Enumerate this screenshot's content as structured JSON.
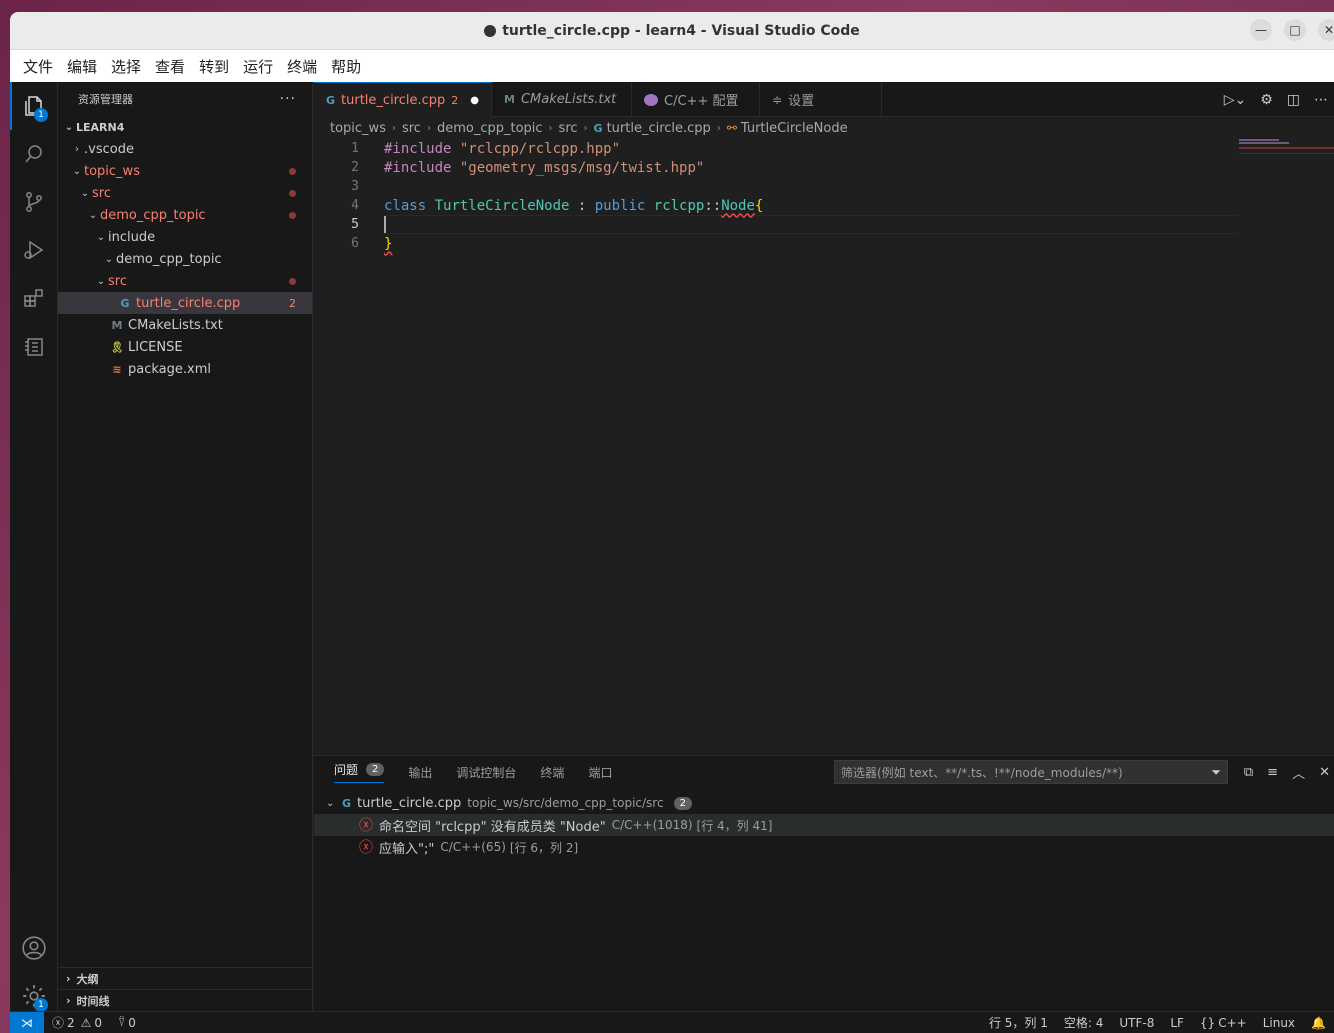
{
  "window": {
    "title": "turtle_circle.cpp - learn4 - Visual Studio Code"
  },
  "menubar": [
    "文件",
    "编辑",
    "选择",
    "查看",
    "转到",
    "运行",
    "终端",
    "帮助"
  ],
  "activity": {
    "explorer_badge": "1",
    "settings_badge": "1"
  },
  "sidebar": {
    "title": "资源管理器",
    "more": "···",
    "root": "LEARN4",
    "tree": [
      {
        "label": ".vscode",
        "indent": 1,
        "chev": "›",
        "modified": false
      },
      {
        "label": "topic_ws",
        "indent": 1,
        "chev": "⌄",
        "modified": true
      },
      {
        "label": "src",
        "indent": 2,
        "chev": "⌄",
        "modified": true
      },
      {
        "label": "demo_cpp_topic",
        "indent": 3,
        "chev": "⌄",
        "modified": true
      },
      {
        "label": "include",
        "indent": 4,
        "chev": "⌄",
        "modified": false
      },
      {
        "label": "demo_cpp_topic",
        "indent": 5,
        "chev": "⌄",
        "modified": false
      },
      {
        "label": "src",
        "indent": 4,
        "chev": "⌄",
        "modified": true
      },
      {
        "label": "turtle_circle.cpp",
        "indent": 5,
        "icon": "G",
        "errors": "2",
        "selected": true
      },
      {
        "label": "CMakeLists.txt",
        "indent": 4,
        "icon": "M"
      },
      {
        "label": "LICENSE",
        "indent": 4,
        "icon": "license"
      },
      {
        "label": "package.xml",
        "indent": 4,
        "icon": "rss"
      }
    ],
    "outline": "大纲",
    "timeline": "时间线"
  },
  "tabs": [
    {
      "label": "turtle_circle.cpp",
      "badge": "2",
      "active": true
    },
    {
      "label": "CMakeLists.txt"
    },
    {
      "label": "C/C++ 配置"
    },
    {
      "label": "设置"
    }
  ],
  "breadcrumb": [
    "topic_ws",
    "src",
    "demo_cpp_topic",
    "src",
    "turtle_circle.cpp",
    "TurtleCircleNode"
  ],
  "code": {
    "line_numbers": [
      "1",
      "2",
      "3",
      "4",
      "5",
      "6"
    ],
    "l1_directive": "#include",
    "l1_path": "\"rclcpp/rclcpp.hpp\"",
    "l2_directive": "#include",
    "l2_path": "\"geometry_msgs/msg/twist.hpp\"",
    "l4_class": "class",
    "l4_name": "TurtleCircleNode",
    "l4_colon": " : ",
    "l4_public": "public",
    "l4_ns": "rclcpp",
    "l4_sep": "::",
    "l4_base": "Node",
    "l4_brace": "{",
    "l6_brace": "}"
  },
  "panel": {
    "tabs": [
      "问题",
      "输出",
      "调试控制台",
      "终端",
      "端口"
    ],
    "problems_count": "2",
    "filter_placeholder": "筛选器(例如 text、**/*.ts、!**/node_modules/**)",
    "file": "turtle_circle.cpp",
    "file_path": "topic_ws/src/demo_cpp_topic/src",
    "file_count": "2",
    "problems": [
      {
        "message": "命名空间 \"rclcpp\" 没有成员类 \"Node\"",
        "source": "C/C++(1018)",
        "location": "[行 4，列 41]"
      },
      {
        "message": "应输入\";\"",
        "source": "C/C++(65)",
        "location": "[行 6，列 2]"
      }
    ]
  },
  "status": {
    "errors": "2",
    "warnings": "0",
    "ports": "0",
    "position": "行 5，列 1",
    "spaces": "空格: 4",
    "encoding": "UTF-8",
    "eol": "LF",
    "language": "C++",
    "platform": "Linux"
  }
}
